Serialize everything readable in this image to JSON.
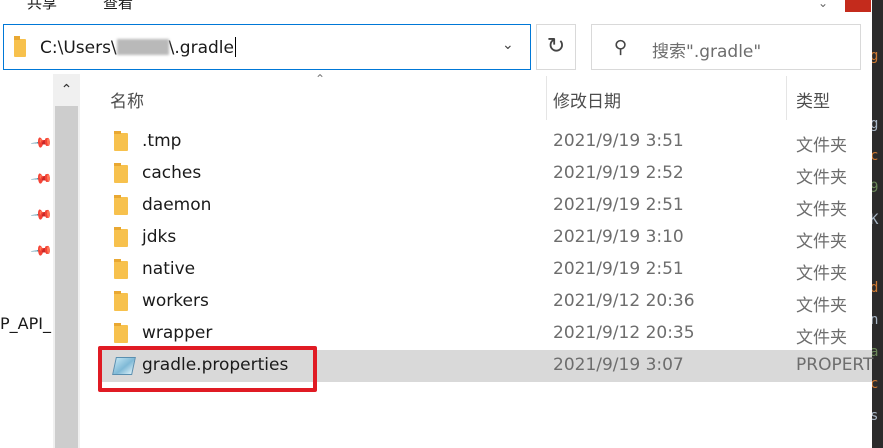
{
  "ribbon": {
    "tabs": [
      "共享",
      "查看"
    ]
  },
  "address_bar": {
    "path_prefix": "C:\\Users\\",
    "path_suffix": "\\.gradle"
  },
  "search": {
    "placeholder": "搜索\".gradle\""
  },
  "nav": {
    "partial_label": "P_API_"
  },
  "columns": {
    "name": "名称",
    "date": "修改日期",
    "type": "类型"
  },
  "files": [
    {
      "name": ".tmp",
      "date": "2021/9/19 3:51",
      "type": "文件夹",
      "kind": "folder"
    },
    {
      "name": "caches",
      "date": "2021/9/19 2:52",
      "type": "文件夹",
      "kind": "folder"
    },
    {
      "name": "daemon",
      "date": "2021/9/19 2:51",
      "type": "文件夹",
      "kind": "folder"
    },
    {
      "name": "jdks",
      "date": "2021/9/19 3:10",
      "type": "文件夹",
      "kind": "folder"
    },
    {
      "name": "native",
      "date": "2021/9/19 2:51",
      "type": "文件夹",
      "kind": "folder"
    },
    {
      "name": "workers",
      "date": "2021/9/12 20:36",
      "type": "文件夹",
      "kind": "folder"
    },
    {
      "name": "wrapper",
      "date": "2021/9/12 20:35",
      "type": "文件夹",
      "kind": "folder"
    },
    {
      "name": "gradle.properties",
      "date": "2021/9/19 3:07",
      "type": "PROPERT",
      "kind": "file",
      "selected": true
    }
  ],
  "colors": {
    "highlight": "#e01b24",
    "selection": "#d9d9d9",
    "folder": "#f7c14d",
    "address_border": "#0078d7"
  },
  "icons": [
    "folder-icon",
    "refresh-icon",
    "search-icon",
    "chevron-down-icon",
    "chevron-up-icon",
    "pin-icon",
    "properties-file-icon"
  ]
}
